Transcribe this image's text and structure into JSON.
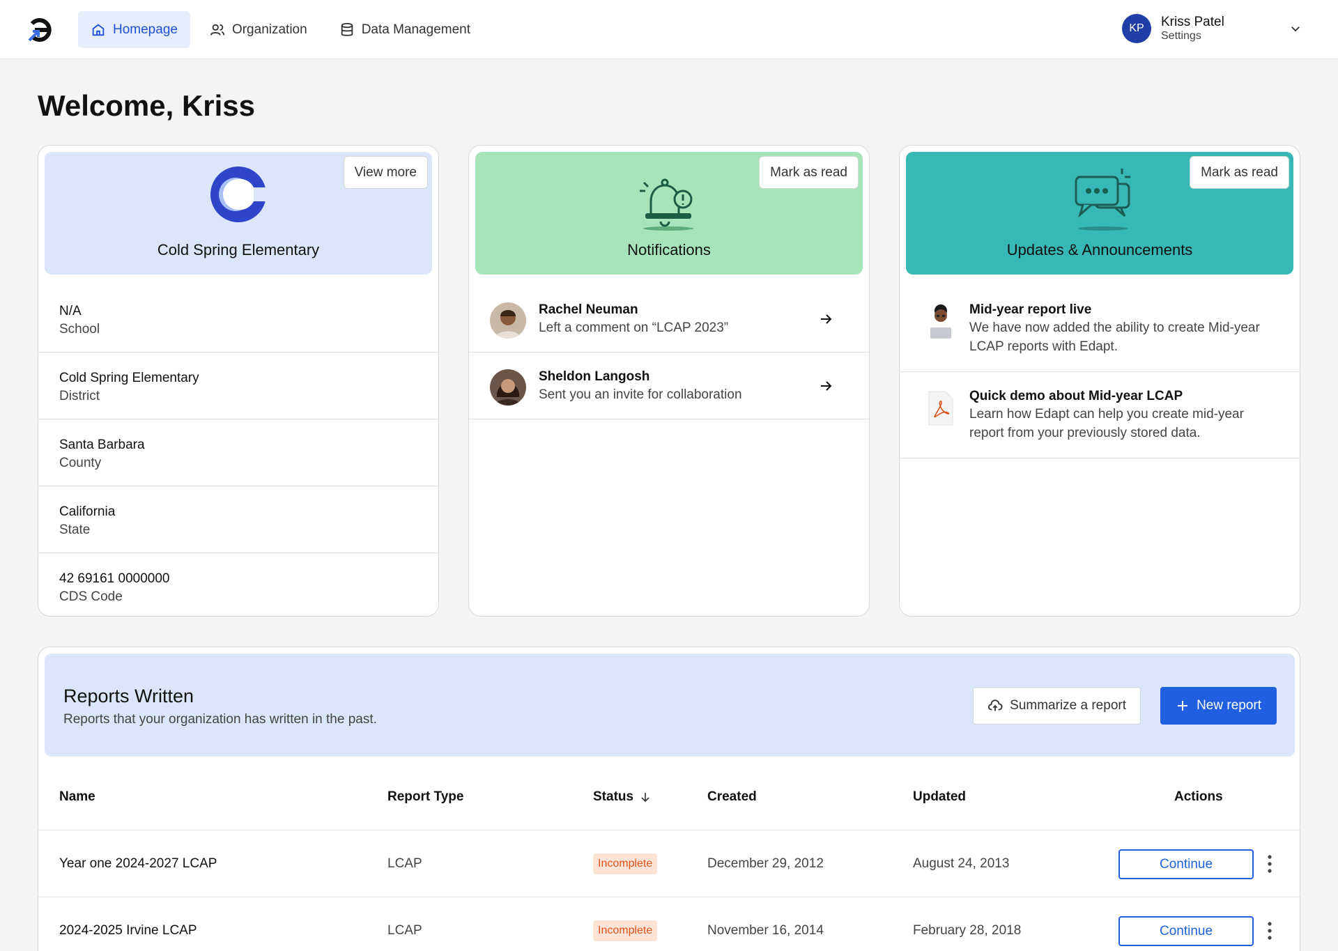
{
  "nav": {
    "logo_icon": "brand-logo-icon",
    "items": [
      {
        "label": "Homepage",
        "icon": "home-icon",
        "active": true
      },
      {
        "label": "Organization",
        "icon": "users-icon",
        "active": false
      },
      {
        "label": "Data Management",
        "icon": "database-icon",
        "active": false
      }
    ],
    "user": {
      "initials": "KP",
      "name": "Kriss Patel",
      "subtitle": "Settings"
    }
  },
  "welcome": "Welcome, Kriss",
  "school_card": {
    "title": "Cold Spring Elementary",
    "button": "View more",
    "rows": [
      {
        "value": "N/A",
        "label": "School"
      },
      {
        "value": "Cold Spring Elementary",
        "label": "District"
      },
      {
        "value": "Santa Barbara",
        "label": "County"
      },
      {
        "value": "California",
        "label": "State"
      },
      {
        "value": "42 69161 0000000",
        "label": "CDS Code"
      }
    ]
  },
  "notifications": {
    "title": "Notifications",
    "button": "Mark as read",
    "items": [
      {
        "name": "Rachel Neuman",
        "text": "Left a comment on “LCAP 2023”"
      },
      {
        "name": "Sheldon Langosh",
        "text": "Sent you an invite for collaboration"
      }
    ]
  },
  "updates": {
    "title": "Updates & Announcements",
    "button": "Mark as read",
    "items": [
      {
        "title": "Mid-year report live",
        "body": "We have now added the ability to create Mid-year LCAP reports with Edapt."
      },
      {
        "title": "Quick demo about Mid-year LCAP",
        "body": "Learn how Edapt can help you create mid-year report from your previously stored data."
      }
    ]
  },
  "reports": {
    "title": "Reports Written",
    "subtitle": "Reports that your organization has written in the past.",
    "summarize_label": "Summarize a report",
    "new_label": "New report",
    "columns": [
      "Name",
      "Report Type",
      "Status",
      "Created",
      "Updated",
      "Actions"
    ],
    "rows": [
      {
        "name": "Year one 2024-2027 LCAP",
        "type": "LCAP",
        "status": "Incomplete",
        "created": "December 29, 2012",
        "updated": "August 24, 2013",
        "action": "Continue"
      },
      {
        "name": "2024-2025 Irvine LCAP",
        "type": "LCAP",
        "status": "Incomplete",
        "created": "November 16, 2014",
        "updated": "February 28, 2018",
        "action": "Continue"
      }
    ]
  },
  "colors": {
    "primary": "#1f5fe0",
    "school_head": "#dbe6fa",
    "notif_head": "#a8e4b9",
    "updates_head": "#38b8b4",
    "badge_bg": "#fde4d6",
    "badge_text": "#e0521a"
  }
}
